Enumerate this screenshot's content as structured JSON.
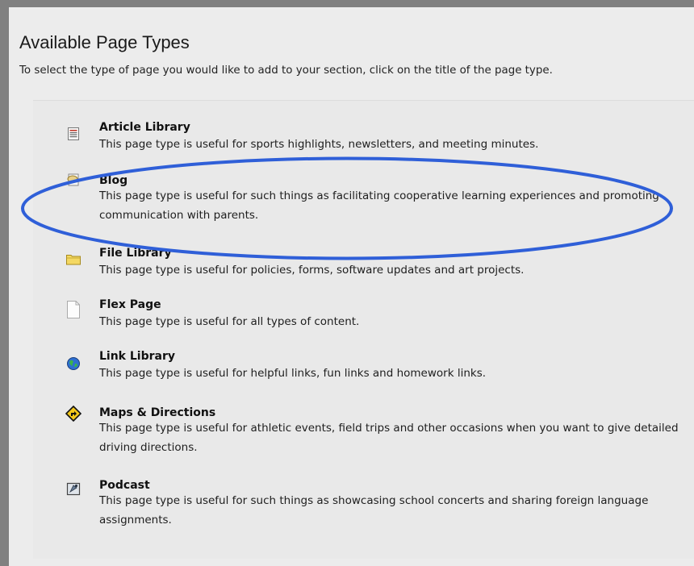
{
  "header": {
    "title": "Available Page Types",
    "subtitle": "To select the type of page you would like to add to your section, click on the title of the page type."
  },
  "page_types": [
    {
      "title": "Article Library",
      "description": "This page type is useful for sports highlights, newsletters, and meeting minutes.",
      "icon": "article-library-icon"
    },
    {
      "title": "Blog",
      "description": "This page type is useful for such things as facilitating cooperative learning experiences and promoting communication with parents.",
      "icon": "blog-icon"
    },
    {
      "title": "File Library",
      "description": "This page type is useful for policies, forms, software updates and art projects.",
      "icon": "folder-icon"
    },
    {
      "title": "Flex Page",
      "description": "This page type is useful for all types of content.",
      "icon": "blank-page-icon"
    },
    {
      "title": "Link Library",
      "description": "This page type is useful for helpful links, fun links and homework links.",
      "icon": "globe-icon"
    },
    {
      "title": "Maps & Directions",
      "description": "This page type is useful for athletic events, field trips and other occasions when you want to give detailed driving directions.",
      "icon": "directions-sign-icon"
    },
    {
      "title": "Podcast",
      "description": "This page type is useful for such things as showcasing school concerts and sharing foreign language assignments.",
      "icon": "podcast-icon"
    }
  ],
  "annotation": {
    "highlight_color": "#2f5fd8",
    "highlighted_item": "Blog"
  }
}
